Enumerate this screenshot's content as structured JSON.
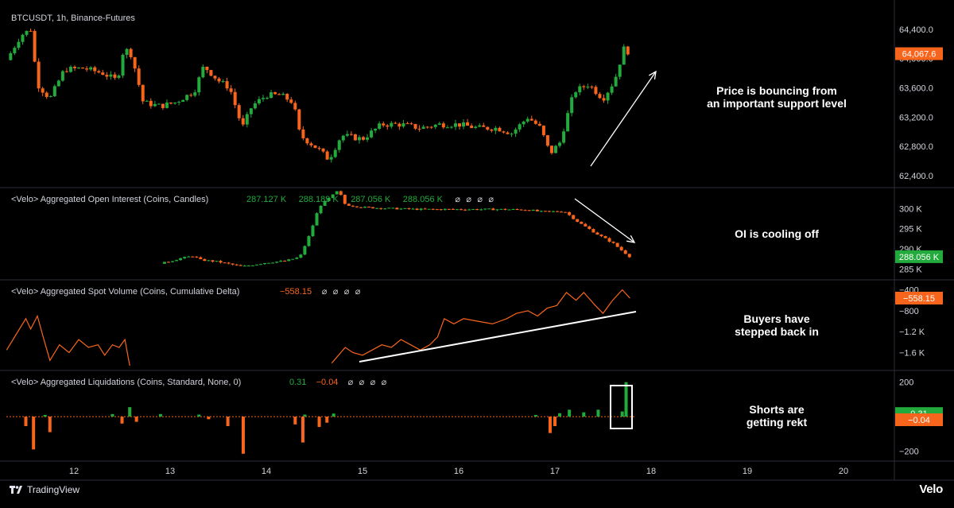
{
  "brand": {
    "name": "TradingView",
    "logo": "Velo"
  },
  "colors": {
    "up": "#22ab3c",
    "down": "#f7651d",
    "background": "#000000",
    "axis_text": "#d1d4dc",
    "pane_border": "#2a2e39",
    "annotation": "#ffffff"
  },
  "x_axis": {
    "labels": [
      "12",
      "13",
      "14",
      "15",
      "16",
      "17",
      "18",
      "19",
      "20"
    ]
  },
  "chart_data": [
    {
      "type": "candlestick",
      "title": "BTCUSDT, 1h, Binance-Futures",
      "ylim": [
        62300,
        64650
      ],
      "y_ticks": [
        "64,400.0",
        "64,000.0",
        "63,600.0",
        "63,200.0",
        "62,800.0",
        "62,400.0"
      ],
      "last_value_label": "64,067.6",
      "annotation": [
        "Price is bouncing from",
        "an important support level"
      ],
      "x_range": [
        "11.3",
        "18"
      ],
      "close_path": [
        {
          "x": "11.30",
          "y": 63980
        },
        {
          "x": "11.45",
          "y": 64320
        },
        {
          "x": "11.55",
          "y": 64400
        },
        {
          "x": "11.62",
          "y": 63650
        },
        {
          "x": "11.75",
          "y": 63450
        },
        {
          "x": "11.90",
          "y": 63850
        },
        {
          "x": "12.10",
          "y": 63870
        },
        {
          "x": "12.30",
          "y": 63800
        },
        {
          "x": "12.45",
          "y": 63700
        },
        {
          "x": "12.52",
          "y": 64150
        },
        {
          "x": "12.60",
          "y": 64050
        },
        {
          "x": "12.72",
          "y": 63400
        },
        {
          "x": "12.90",
          "y": 63350
        },
        {
          "x": "13.05",
          "y": 63400
        },
        {
          "x": "13.25",
          "y": 63550
        },
        {
          "x": "13.35",
          "y": 63900
        },
        {
          "x": "13.50",
          "y": 63700
        },
        {
          "x": "13.62",
          "y": 63600
        },
        {
          "x": "13.75",
          "y": 63050
        },
        {
          "x": "13.85",
          "y": 63350
        },
        {
          "x": "14.00",
          "y": 63500
        },
        {
          "x": "14.15",
          "y": 63500
        },
        {
          "x": "14.28",
          "y": 63400
        },
        {
          "x": "14.35",
          "y": 62950
        },
        {
          "x": "14.55",
          "y": 62750
        },
        {
          "x": "14.65",
          "y": 62620
        },
        {
          "x": "14.78",
          "y": 62950
        },
        {
          "x": "15.00",
          "y": 62900
        },
        {
          "x": "15.20",
          "y": 63100
        },
        {
          "x": "15.40",
          "y": 63100
        },
        {
          "x": "15.60",
          "y": 63050
        },
        {
          "x": "15.80",
          "y": 63100
        },
        {
          "x": "16.00",
          "y": 63100
        },
        {
          "x": "16.20",
          "y": 63050
        },
        {
          "x": "16.40",
          "y": 63050
        },
        {
          "x": "16.55",
          "y": 62980
        },
        {
          "x": "16.72",
          "y": 63200
        },
        {
          "x": "16.85",
          "y": 63050
        },
        {
          "x": "16.95",
          "y": 62700
        },
        {
          "x": "17.05",
          "y": 62850
        },
        {
          "x": "17.20",
          "y": 63550
        },
        {
          "x": "17.35",
          "y": 63650
        },
        {
          "x": "17.50",
          "y": 63450
        },
        {
          "x": "17.62",
          "y": 63700
        },
        {
          "x": "17.72",
          "y": 64150
        },
        {
          "x": "17.78",
          "y": 64067.6
        }
      ]
    },
    {
      "type": "candlestick",
      "title": "<Velo> Aggregated Open Interest (Coins, Candles)",
      "header_values": [
        "287.127 K",
        "288.189 K",
        "287.056 K",
        "288.056 K"
      ],
      "ylim": [
        283500,
        304000
      ],
      "y_ticks": [
        "300 K",
        "295 K",
        "290 K",
        "285 K"
      ],
      "last_value_label": "288.056 K",
      "annotation": [
        "OI is cooling off"
      ],
      "close_path": [
        {
          "x": "12.90",
          "y": 286300
        },
        {
          "x": "13.10",
          "y": 287600
        },
        {
          "x": "13.25",
          "y": 288300
        },
        {
          "x": "13.30",
          "y": 287300
        },
        {
          "x": "13.50",
          "y": 286800
        },
        {
          "x": "13.75",
          "y": 285600
        },
        {
          "x": "14.00",
          "y": 286600
        },
        {
          "x": "14.20",
          "y": 287000
        },
        {
          "x": "14.35",
          "y": 288000
        },
        {
          "x": "14.45",
          "y": 293500
        },
        {
          "x": "14.55",
          "y": 300500
        },
        {
          "x": "14.65",
          "y": 302500
        },
        {
          "x": "14.75",
          "y": 304500
        },
        {
          "x": "14.82",
          "y": 301000
        },
        {
          "x": "15.00",
          "y": 300300
        },
        {
          "x": "15.30",
          "y": 300000
        },
        {
          "x": "15.60",
          "y": 299800
        },
        {
          "x": "16.00",
          "y": 299800
        },
        {
          "x": "16.40",
          "y": 299800
        },
        {
          "x": "16.72",
          "y": 299700
        },
        {
          "x": "16.85",
          "y": 299200
        },
        {
          "x": "17.10",
          "y": 299300
        },
        {
          "x": "17.25",
          "y": 296500
        },
        {
          "x": "17.45",
          "y": 293500
        },
        {
          "x": "17.60",
          "y": 291500
        },
        {
          "x": "17.70",
          "y": 289500
        },
        {
          "x": "17.78",
          "y": 288056
        }
      ]
    },
    {
      "type": "line",
      "title": "<Velo> Aggregated Spot Volume (Coins, Cumulative Delta)",
      "header_values": [
        "−558.15"
      ],
      "ylim": [
        -1850,
        -300
      ],
      "y_ticks": [
        "−400",
        "−800",
        "−1.2 K",
        "−1.6 K"
      ],
      "last_value_label": "−558.15",
      "annotation": [
        "Buyers have",
        "stepped back in"
      ],
      "segments": [
        [
          {
            "x": "11.30",
            "y": -1550
          },
          {
            "x": "11.40",
            "y": -1250
          },
          {
            "x": "11.50",
            "y": -950
          },
          {
            "x": "11.55",
            "y": -1150
          },
          {
            "x": "11.62",
            "y": -900
          },
          {
            "x": "11.68",
            "y": -1300
          },
          {
            "x": "11.75",
            "y": -1750
          },
          {
            "x": "11.85",
            "y": -1450
          },
          {
            "x": "11.95",
            "y": -1600
          },
          {
            "x": "12.05",
            "y": -1350
          },
          {
            "x": "12.15",
            "y": -1500
          },
          {
            "x": "12.25",
            "y": -1450
          },
          {
            "x": "12.32",
            "y": -1650
          },
          {
            "x": "12.40",
            "y": -1450
          },
          {
            "x": "12.47",
            "y": -1500
          },
          {
            "x": "12.53",
            "y": -1350
          },
          {
            "x": "12.58",
            "y": -1850
          }
        ],
        [
          {
            "x": "14.68",
            "y": -1800
          },
          {
            "x": "14.75",
            "y": -1650
          },
          {
            "x": "14.82",
            "y": -1500
          },
          {
            "x": "14.90",
            "y": -1600
          },
          {
            "x": "15.00",
            "y": -1650
          },
          {
            "x": "15.10",
            "y": -1550
          },
          {
            "x": "15.20",
            "y": -1450
          },
          {
            "x": "15.30",
            "y": -1500
          },
          {
            "x": "15.40",
            "y": -1350
          },
          {
            "x": "15.50",
            "y": -1450
          },
          {
            "x": "15.60",
            "y": -1550
          },
          {
            "x": "15.70",
            "y": -1450
          },
          {
            "x": "15.78",
            "y": -1300
          },
          {
            "x": "15.85",
            "y": -950
          },
          {
            "x": "15.95",
            "y": -1050
          },
          {
            "x": "16.05",
            "y": -950
          },
          {
            "x": "16.20",
            "y": -1000
          },
          {
            "x": "16.35",
            "y": -1050
          },
          {
            "x": "16.50",
            "y": -950
          },
          {
            "x": "16.60",
            "y": -850
          },
          {
            "x": "16.72",
            "y": -800
          },
          {
            "x": "16.82",
            "y": -900
          },
          {
            "x": "16.92",
            "y": -750
          },
          {
            "x": "17.02",
            "y": -700
          },
          {
            "x": "17.12",
            "y": -450
          },
          {
            "x": "17.22",
            "y": -600
          },
          {
            "x": "17.30",
            "y": -450
          },
          {
            "x": "17.42",
            "y": -700
          },
          {
            "x": "17.50",
            "y": -850
          },
          {
            "x": "17.60",
            "y": -600
          },
          {
            "x": "17.70",
            "y": -400
          },
          {
            "x": "17.78",
            "y": -558.15
          }
        ]
      ]
    },
    {
      "type": "bar",
      "title": "<Velo> Aggregated Liquidations (Coins, Standard, None, 0)",
      "header_values": [
        "0.31",
        "−0.04"
      ],
      "ylim": [
        -230,
        240
      ],
      "y_ticks": [
        "200",
        "−200"
      ],
      "last_value_labels": [
        "0.31",
        "−0.04"
      ],
      "annotation": [
        "Shorts are",
        "getting rekt"
      ],
      "shorts": [
        {
          "x": "11.70",
          "y": 10
        },
        {
          "x": "12.40",
          "y": 15
        },
        {
          "x": "12.58",
          "y": 55
        },
        {
          "x": "12.90",
          "y": 15
        },
        {
          "x": "13.30",
          "y": 12
        },
        {
          "x": "14.40",
          "y": 12
        },
        {
          "x": "14.70",
          "y": 18
        },
        {
          "x": "16.80",
          "y": 10
        },
        {
          "x": "17.05",
          "y": 20
        },
        {
          "x": "17.15",
          "y": 40
        },
        {
          "x": "17.30",
          "y": 25
        },
        {
          "x": "17.45",
          "y": 40
        },
        {
          "x": "17.70",
          "y": 30
        },
        {
          "x": "17.74",
          "y": 200
        }
      ],
      "longs": [
        {
          "x": "11.50",
          "y": 55
        },
        {
          "x": "11.58",
          "y": 190
        },
        {
          "x": "11.75",
          "y": 90
        },
        {
          "x": "12.50",
          "y": 40
        },
        {
          "x": "12.65",
          "y": 30
        },
        {
          "x": "13.40",
          "y": 15
        },
        {
          "x": "13.60",
          "y": 55
        },
        {
          "x": "13.76",
          "y": 215
        },
        {
          "x": "14.30",
          "y": 45
        },
        {
          "x": "14.38",
          "y": 150
        },
        {
          "x": "14.55",
          "y": 60
        },
        {
          "x": "14.63",
          "y": 35
        },
        {
          "x": "16.95",
          "y": 95
        },
        {
          "x": "17.00",
          "y": 55
        }
      ]
    }
  ]
}
